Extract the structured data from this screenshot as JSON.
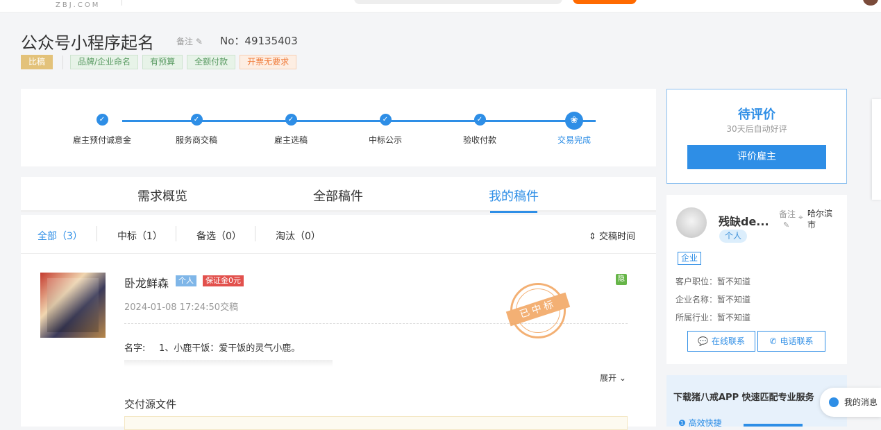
{
  "header": {
    "logo_text": "ZBJ.COM"
  },
  "task": {
    "title": "公众号小程序起名",
    "note_label": "备注",
    "order_no": "No：49135403",
    "type_tag": "比稿",
    "tags": [
      "品牌/企业命名",
      "有预算",
      "全额付款",
      "开票无要求"
    ]
  },
  "steps": [
    {
      "label": "雇主预付诚意金"
    },
    {
      "label": "服务商交稿"
    },
    {
      "label": "雇主选稿"
    },
    {
      "label": "中标公示"
    },
    {
      "label": "验收付款"
    },
    {
      "label": "交易完成"
    }
  ],
  "tabs": [
    {
      "label": "需求概览"
    },
    {
      "label": "全部稿件"
    },
    {
      "label": "我的稿件"
    }
  ],
  "filters": [
    {
      "label": "全部（3）"
    },
    {
      "label": "中标（1）"
    },
    {
      "label": "备选（0）"
    },
    {
      "label": "淘汰（0）"
    }
  ],
  "sort_label": "交稿时间",
  "entry": {
    "author": "卧龙鲜森",
    "badge_person": "个人",
    "badge_deposit": "保证金0元",
    "hide_label": "隐",
    "submit_time": "2024-01-08 17:24:50交稿",
    "stamp_text": "已中标",
    "name_label": "名字:",
    "name_value": "1、小鹿干饭：爱干饭的灵气小鹿。",
    "expand_label": "展开",
    "files_title": "交付源文件"
  },
  "review": {
    "title": "待评价",
    "subtitle": "30天后自动好评",
    "button": "评价雇主"
  },
  "employer": {
    "name": "残缺de...",
    "badge": "个人",
    "note_label": "备注",
    "location": "哈尔滨市",
    "type": "企业",
    "rows": [
      {
        "label": "客户职位：暂不知道"
      },
      {
        "label": "企业名称：暂不知道"
      },
      {
        "label": "所属行业：暂不知道"
      }
    ],
    "online_contact": "在线联系",
    "phone_contact": "电话联系"
  },
  "promo": {
    "title": "下载猪八戒APP 快速匹配专业服务",
    "item": "高效快捷"
  },
  "messages": {
    "label": "我的消息"
  }
}
